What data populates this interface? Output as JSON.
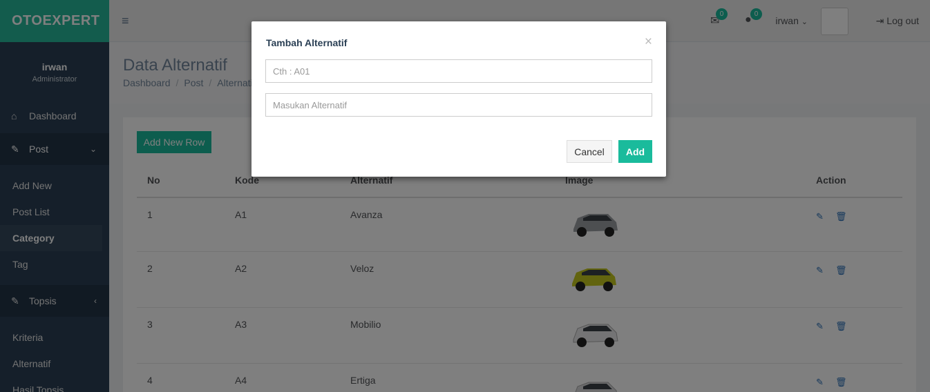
{
  "brand": "OTOEXPERT",
  "profile": {
    "name": "irwan",
    "role": "Administrator"
  },
  "sidebar": {
    "dashboard": "Dashboard",
    "post": "Post",
    "post_items": [
      "Add New",
      "Post List",
      "Category",
      "Tag"
    ],
    "topsis": "Topsis",
    "topsis_items": [
      "Kriteria",
      "Alternatif",
      "Hasil Topsis"
    ]
  },
  "topbar": {
    "mail_count": "0",
    "chat_count": "0",
    "username": "irwan",
    "logout": "Log out"
  },
  "page": {
    "title": "Data Alternatif",
    "breadcrumb": [
      "Dashboard",
      "Post",
      "Alternatif"
    ]
  },
  "table": {
    "add_button": "Add New Row",
    "headers": [
      "No",
      "Kode",
      "Alternatif",
      "Image",
      "Action"
    ],
    "rows": [
      {
        "no": "1",
        "kode": "A1",
        "alternatif": "Avanza",
        "car_color": "#9a9ea3"
      },
      {
        "no": "2",
        "kode": "A2",
        "alternatif": "Veloz",
        "car_color": "#c5c81e"
      },
      {
        "no": "3",
        "kode": "A3",
        "alternatif": "Mobilio",
        "car_color": "#e9e9ea"
      },
      {
        "no": "4",
        "kode": "A4",
        "alternatif": "Ertiga",
        "car_color": "#d8d9db"
      }
    ]
  },
  "modal": {
    "title": "Tambah Alternatif",
    "close": "×",
    "kode_placeholder": "Cth : A01",
    "alternatif_placeholder": "Masukan Alternatif",
    "cancel": "Cancel",
    "add": "Add"
  },
  "colors": {
    "accent": "#1abb9c",
    "sidebar": "#2a3f54"
  }
}
